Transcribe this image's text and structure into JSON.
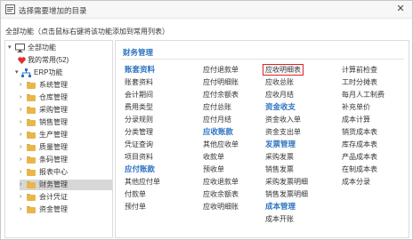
{
  "window": {
    "title": "选择需要增加的目录",
    "close_glyph": "✕"
  },
  "hint": "全部功能（点击鼠标右键将该功能添加到常用列表）",
  "tree": {
    "root": "全部功能",
    "favorites": "我的常用(52)",
    "erp": "ERP功能",
    "items": [
      "系统管理",
      "仓库管理",
      "采购管理",
      "销售管理",
      "生产管理",
      "质量管理",
      "条码管理",
      "报表中心",
      "财务管理",
      "会计凭证",
      "资金管理"
    ],
    "selected": "财务管理"
  },
  "content": {
    "section_title": "财务管理",
    "columns": [
      [
        {
          "t": "账套资料",
          "cat": true
        },
        {
          "t": "账套资料"
        },
        {
          "t": "会计期间"
        },
        {
          "t": "费用类型"
        },
        {
          "t": "分录规则"
        },
        {
          "t": "分类管理"
        },
        {
          "t": "凭证查询"
        },
        {
          "t": "项目资料"
        },
        {
          "t": "应付账款",
          "cat": true
        },
        {
          "t": "其他应付单"
        },
        {
          "t": "付款单"
        },
        {
          "t": "预付单"
        }
      ],
      [
        {
          "t": "应付退款单"
        },
        {
          "t": "应付明细账"
        },
        {
          "t": "应付余额表"
        },
        {
          "t": "应付总账"
        },
        {
          "t": "应付月结"
        },
        {
          "t": "应收账款",
          "cat": true
        },
        {
          "t": "其他应收单"
        },
        {
          "t": "收款单"
        },
        {
          "t": "预收单"
        },
        {
          "t": "应收退款单"
        },
        {
          "t": "应收余额表"
        },
        {
          "t": "应收明细账"
        }
      ],
      [
        {
          "t": "应收明细表",
          "hl": true
        },
        {
          "t": "应收总账"
        },
        {
          "t": "应收月结"
        },
        {
          "t": "资金收支",
          "cat": true
        },
        {
          "t": "资金收入单"
        },
        {
          "t": "资金支出单"
        },
        {
          "t": "发票管理",
          "cat": true
        },
        {
          "t": "采购发票"
        },
        {
          "t": "销售发票"
        },
        {
          "t": "采购发票明细"
        },
        {
          "t": "销售发票明细"
        },
        {
          "t": "成本管理",
          "cat": true
        },
        {
          "t": "成本开账"
        }
      ],
      [
        {
          "t": "计算前检查"
        },
        {
          "t": "工时分摊表"
        },
        {
          "t": "每月人工制费"
        },
        {
          "t": "补充单价"
        },
        {
          "t": "成本计算"
        },
        {
          "t": "销货成本表"
        },
        {
          "t": "库存成本表"
        },
        {
          "t": "产品成本表"
        },
        {
          "t": "在制成本表"
        },
        {
          "t": "成本分录"
        }
      ]
    ]
  }
}
